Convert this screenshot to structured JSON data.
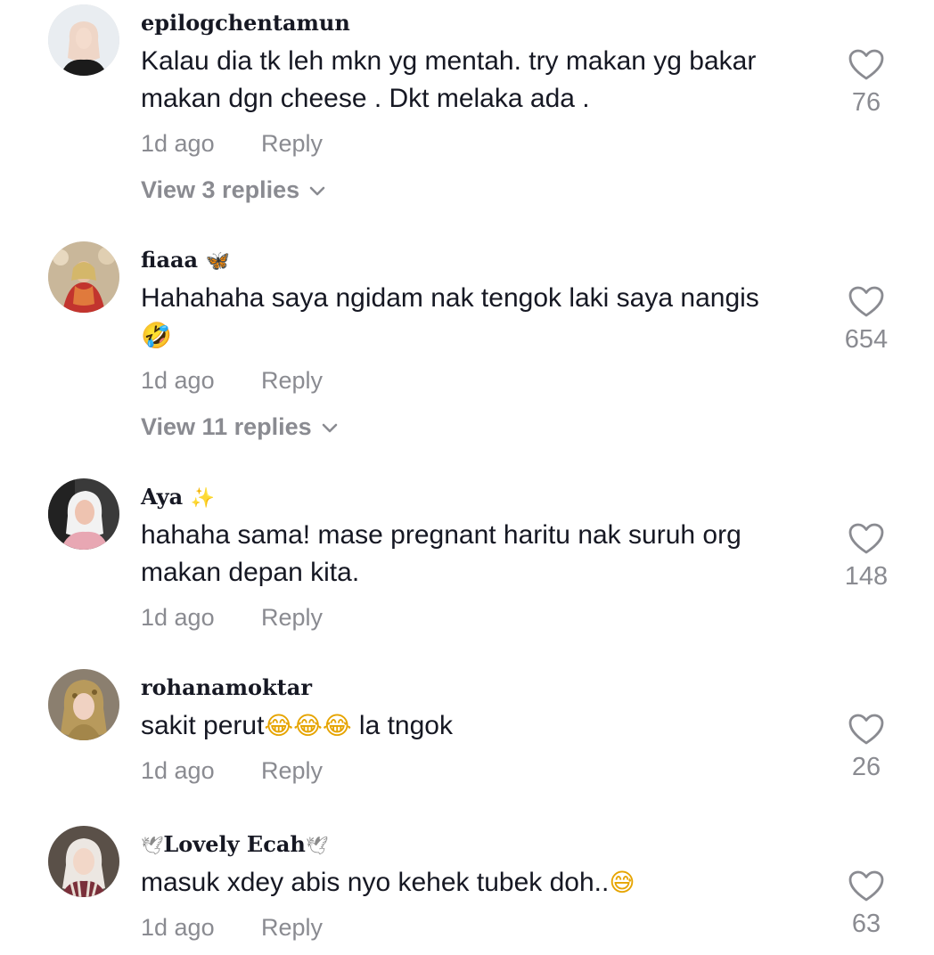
{
  "comments": [
    {
      "username": "epilogchentamun",
      "username_deco": "",
      "text": "Kalau dia tk leh mkn yg mentah. try makan yg bakar makan dgn cheese . Dkt melaka ada .",
      "time": "1d ago",
      "reply_label": "Reply",
      "likes": "76",
      "view_replies": "View 3 replies"
    },
    {
      "username": "fiaaa",
      "username_deco": "🦋",
      "text": "Hahahaha saya ngidam nak tengok laki saya nangis",
      "emoji": "🤣",
      "time": "1d ago",
      "reply_label": "Reply",
      "likes": "654",
      "view_replies": "View 11 replies"
    },
    {
      "username": "Aya",
      "username_deco": "✨",
      "text": "hahaha sama! mase pregnant haritu nak suruh org makan depan kita.",
      "time": "1d ago",
      "reply_label": "Reply",
      "likes": "148"
    },
    {
      "username": "rohanamoktar",
      "username_deco": "",
      "text_before": "sakit perut",
      "emoji": "😂😂😂",
      "text_after": " la tngok",
      "time": "1d ago",
      "reply_label": "Reply",
      "likes": "26"
    },
    {
      "username": "Lovely Ecah",
      "username_deco": "🕊",
      "text": "masuk xdey abis nyo kehek tubek doh..",
      "emoji": "😅",
      "time": "1d ago",
      "reply_label": "Reply",
      "likes": "63"
    }
  ],
  "icons": {
    "like": "heart-outline-icon",
    "expand": "chevron-down-icon"
  },
  "colors": {
    "text": "#161823",
    "muted": "#8a8b91",
    "background": "#ffffff"
  }
}
